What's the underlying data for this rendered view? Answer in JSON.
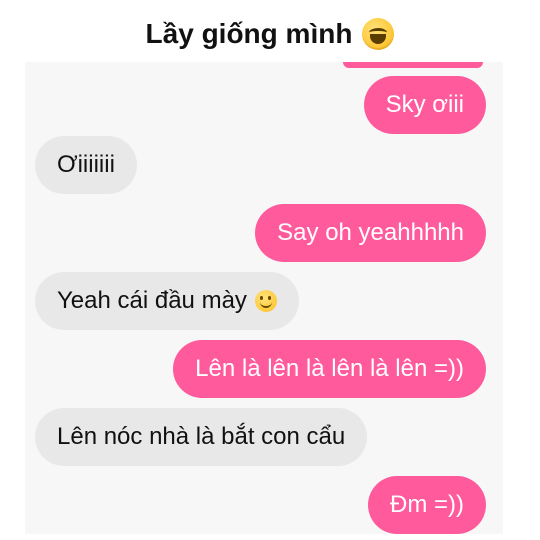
{
  "caption": {
    "text": "Lầy giống mình",
    "emoji": "laughing-tears-emoji"
  },
  "messages": [
    {
      "side": "sent",
      "text": "Sky ơiii"
    },
    {
      "side": "received",
      "text": "Ơiiiiiii"
    },
    {
      "side": "sent",
      "text": "Say oh yeahhhhh"
    },
    {
      "side": "received",
      "text": "Yeah cái đầu mày",
      "emoji": "smiling-face-emoji"
    },
    {
      "side": "sent",
      "text": "Lên là lên là lên là lên =))"
    },
    {
      "side": "received",
      "text": "Lên nóc nhà là bắt con cẩu"
    },
    {
      "side": "sent",
      "text": "Đm =))"
    }
  ],
  "colors": {
    "sent_bubble": "#ff5b9c",
    "received_bubble": "#e8e8e8",
    "chat_background": "#f7f7f7"
  }
}
